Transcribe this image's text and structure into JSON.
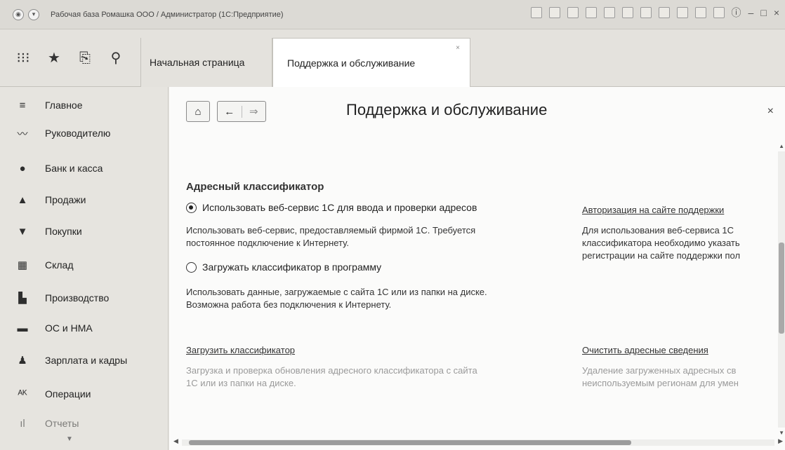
{
  "window": {
    "title": "Рабочая база Ромашка ООО / Администратор  (1С:Предприятие)"
  },
  "toolbar": {
    "icons": [
      "apps-grid-icon",
      "favorites-star-icon",
      "history-icon",
      "search-icon"
    ]
  },
  "tabs": [
    {
      "label": "Начальная страница",
      "active": false
    },
    {
      "label": "Поддержка и обслуживание",
      "active": true
    }
  ],
  "sidebar": {
    "items": [
      {
        "label": "Главное",
        "icon": "menu-lines-icon"
      },
      {
        "label": "Руководителю",
        "icon": "trend-chart-icon"
      },
      {
        "label": "Банк и касса",
        "icon": "coin-icon"
      },
      {
        "label": "Продажи",
        "icon": "shopping-bag-icon"
      },
      {
        "label": "Покупки",
        "icon": "cart-icon"
      },
      {
        "label": "Склад",
        "icon": "warehouse-icon"
      },
      {
        "label": "Производство",
        "icon": "factory-icon"
      },
      {
        "label": "ОС и НМА",
        "icon": "truck-icon"
      },
      {
        "label": "Зарплата и кадры",
        "icon": "person-icon"
      },
      {
        "label": "Операции",
        "icon": "operations-icon"
      },
      {
        "label": "Отчеты",
        "icon": "report-chart-icon"
      }
    ]
  },
  "main": {
    "title": "Поддержка и обслуживание",
    "section_title": "Адресный классификатор",
    "option_web": {
      "label": "Использовать веб-сервис 1С для ввода и проверки адресов",
      "selected": true,
      "desc_line1": "Использовать веб-сервис, предоставляемый фирмой 1С. Требуется",
      "desc_line2": "постоянное подключение к Интернету."
    },
    "auth_link": "Авторизация на сайте поддержки",
    "auth_desc_line1": "Для использования веб-сервиса 1С",
    "auth_desc_line2": "классификатора необходимо указать",
    "auth_desc_line3": "регистрации на сайте поддержки пол",
    "option_load": {
      "label": "Загружать классификатор в программу",
      "selected": false,
      "desc_line1": "Использовать данные, загружаемые с сайта 1С или из папки на диске.",
      "desc_line2": "Возможна работа без подключения к Интернету."
    },
    "load_link": "Загрузить классификатор",
    "load_desc_line1": "Загрузка и проверка обновления адресного классификатора с сайта",
    "load_desc_line2": "1С или из папки на диске.",
    "clear_link": "Очистить адресные сведения",
    "clear_desc_line1": "Удаление загруженных адресных св",
    "clear_desc_line2": "неиспользуемым регионам для умен"
  }
}
